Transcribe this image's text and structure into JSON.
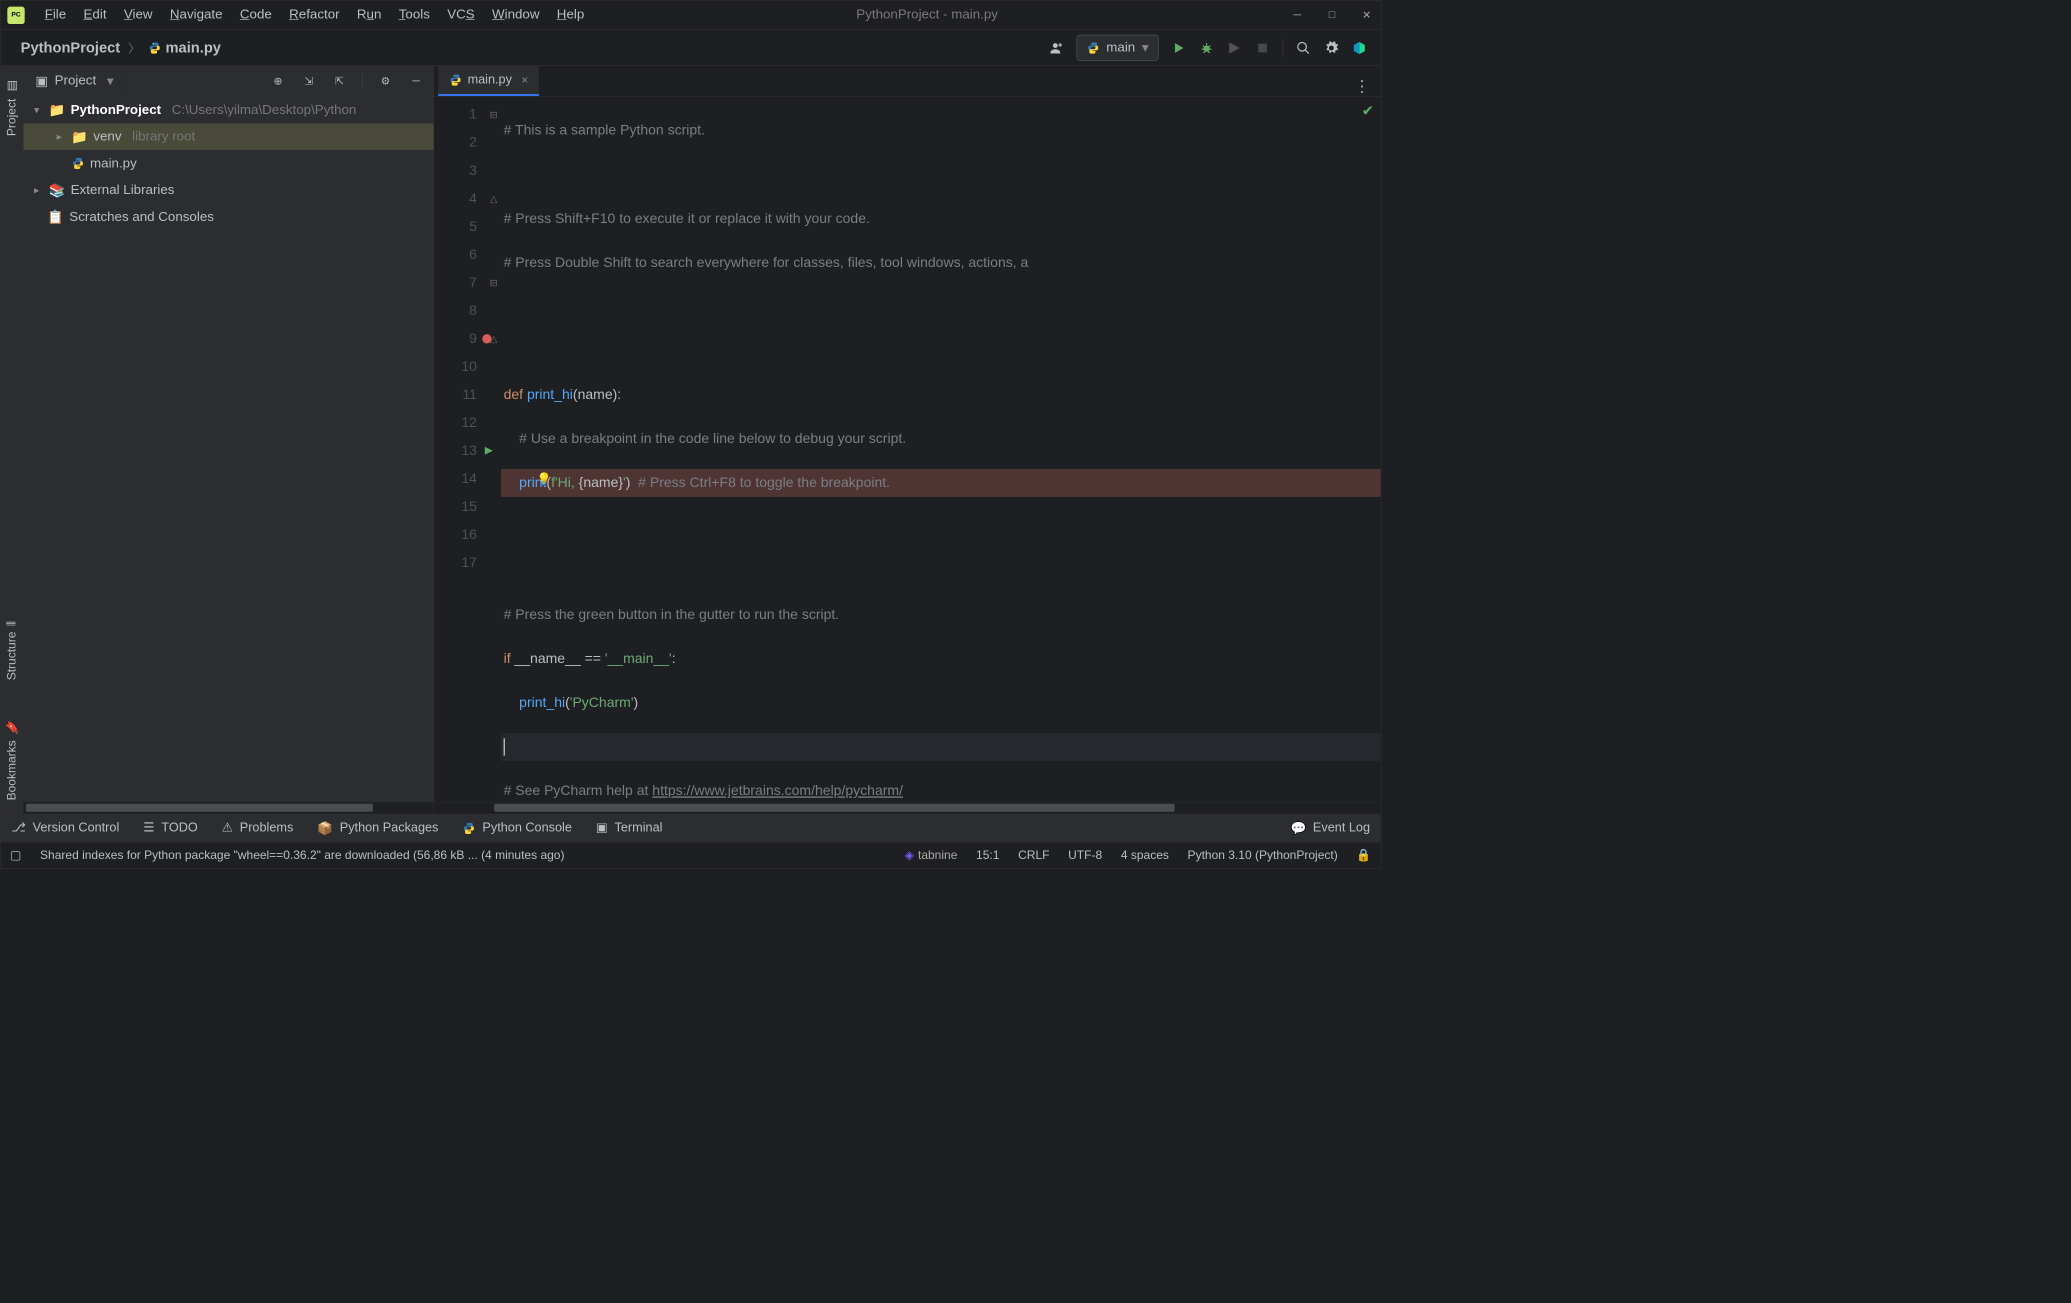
{
  "window": {
    "title": "PythonProject - main.py"
  },
  "menu": [
    "File",
    "Edit",
    "View",
    "Navigate",
    "Code",
    "Refactor",
    "Run",
    "Tools",
    "VCS",
    "Window",
    "Help"
  ],
  "breadcrumb": {
    "project": "PythonProject",
    "file": "main.py"
  },
  "run": {
    "config": "main"
  },
  "sidebar": {
    "tab": "Project",
    "tree": {
      "root": {
        "label": "PythonProject",
        "hint": "C:\\Users\\yilma\\Desktop\\Python"
      },
      "venv": {
        "label": "venv",
        "hint": "library root"
      },
      "mainpy": {
        "label": "main.py"
      },
      "extlib": {
        "label": "External Libraries"
      },
      "scratches": {
        "label": "Scratches and Consoles"
      }
    }
  },
  "leftstrip": {
    "project": "Project",
    "structure": "Structure",
    "bookmarks": "Bookmarks"
  },
  "tab": {
    "label": "main.py"
  },
  "code": {
    "lines": [
      "# This is a sample Python script.",
      "",
      "# Press Shift+F10 to execute it or replace it with your code.",
      "# Press Double Shift to search everywhere for classes, files, tool windows, actions, a",
      "",
      "",
      "def print_hi(name):",
      "    # Use a breakpoint in the code line below to debug your script.",
      "    print(f'Hi, {name}')  # Press Ctrl+F8 to toggle the breakpoint.",
      "",
      "",
      "# Press the green button in the gutter to run the script.",
      "if __name__ == '__main__':",
      "    print_hi('PyCharm')",
      "",
      "# See PyCharm help at https://www.jetbrains.com/help/pycharm/",
      ""
    ]
  },
  "bottom": {
    "vcs": "Version Control",
    "todo": "TODO",
    "problems": "Problems",
    "pkgs": "Python Packages",
    "console": "Python Console",
    "terminal": "Terminal",
    "eventlog": "Event Log"
  },
  "status": {
    "msg": "Shared indexes for Python package \"wheel==0.36.2\" are downloaded (56,86 kB ... (4 minutes ago)",
    "tabnine": "tabnine",
    "pos": "15:1",
    "eol": "CRLF",
    "enc": "UTF-8",
    "indent": "4 spaces",
    "interp": "Python 3.10 (PythonProject)"
  }
}
